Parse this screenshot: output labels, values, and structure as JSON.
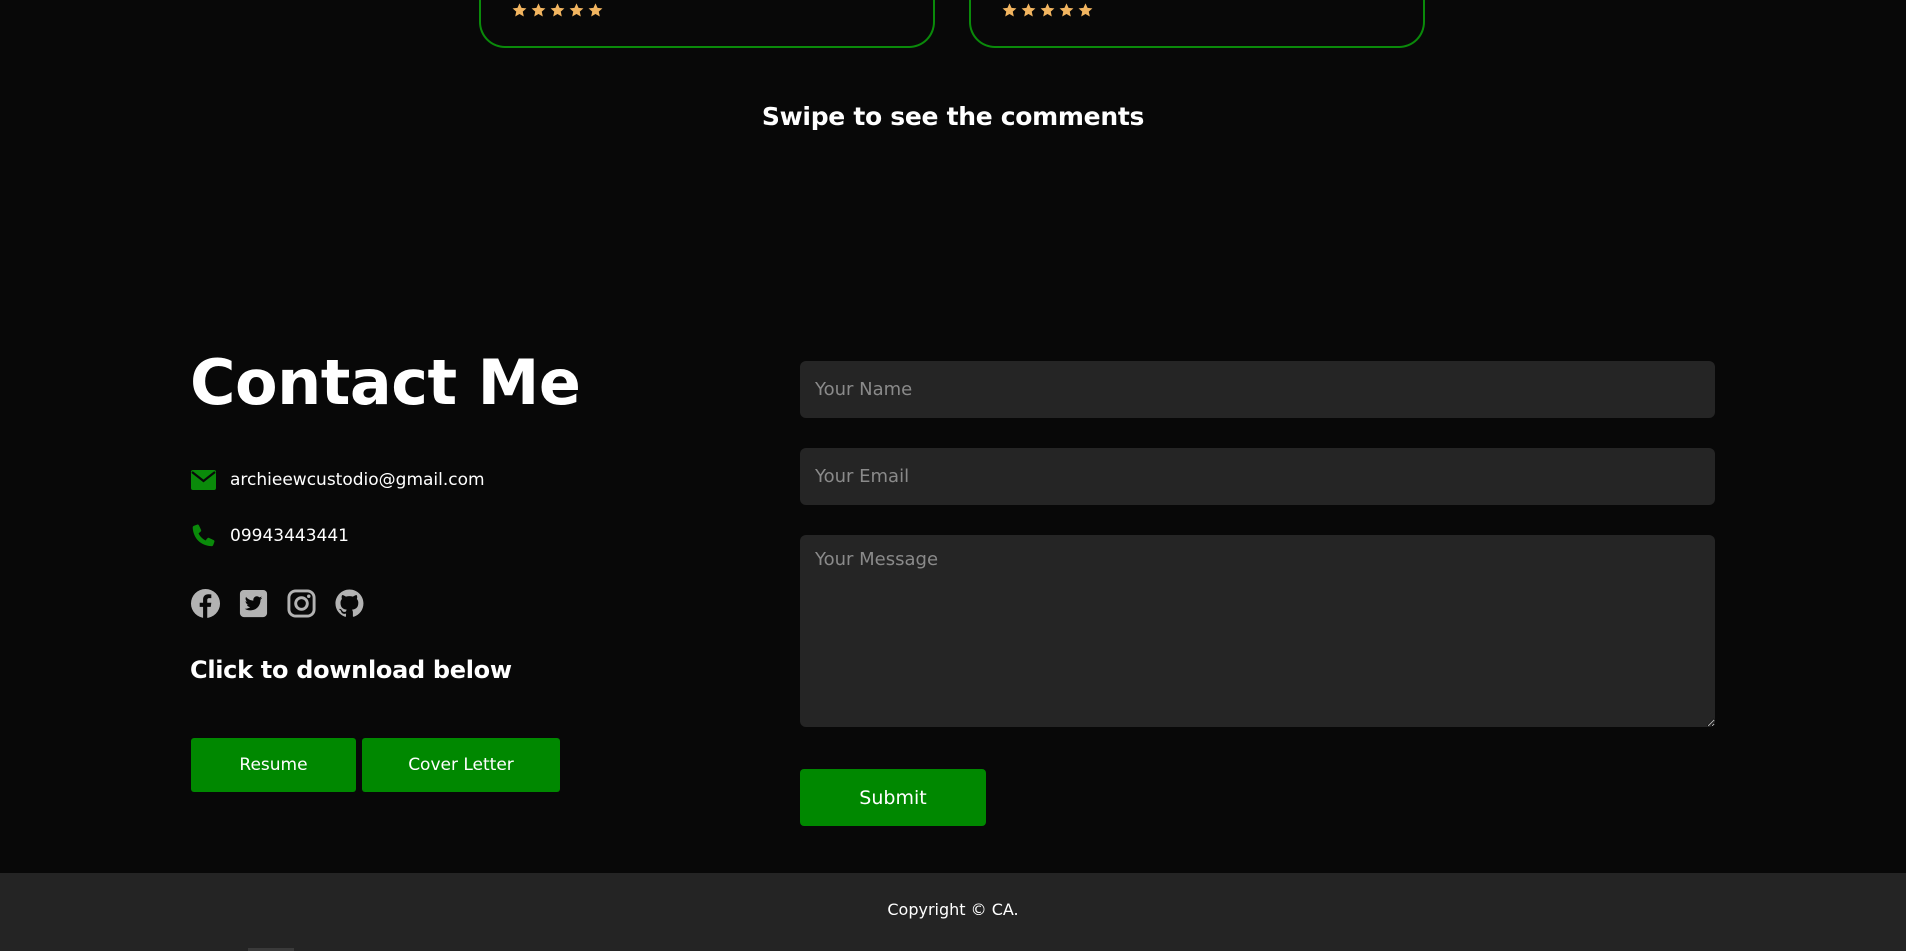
{
  "colors": {
    "background": "#080808",
    "accent": "#008800",
    "card_border": "#0a8a0a",
    "star": "#f2b560",
    "field_bg": "#252525",
    "footer_bg": "#242424"
  },
  "testimonials": {
    "cards": [
      {
        "rating": 5
      },
      {
        "rating": 5
      }
    ],
    "swipe_hint": "Swipe to see the comments"
  },
  "contact": {
    "title": "Contact Me",
    "email": "archieewcustodio@gmail.com",
    "phone": "09943443441",
    "socials": [
      "facebook-icon",
      "twitter-icon",
      "instagram-icon",
      "github-icon"
    ],
    "download_label": "Click to download below",
    "resume_label": "Resume",
    "cover_letter_label": "Cover Letter"
  },
  "form": {
    "name_placeholder": "Your Name",
    "email_placeholder": "Your Email",
    "message_placeholder": "Your Message",
    "submit_label": "Submit"
  },
  "footer": {
    "copyright": "Copyright © CA."
  }
}
